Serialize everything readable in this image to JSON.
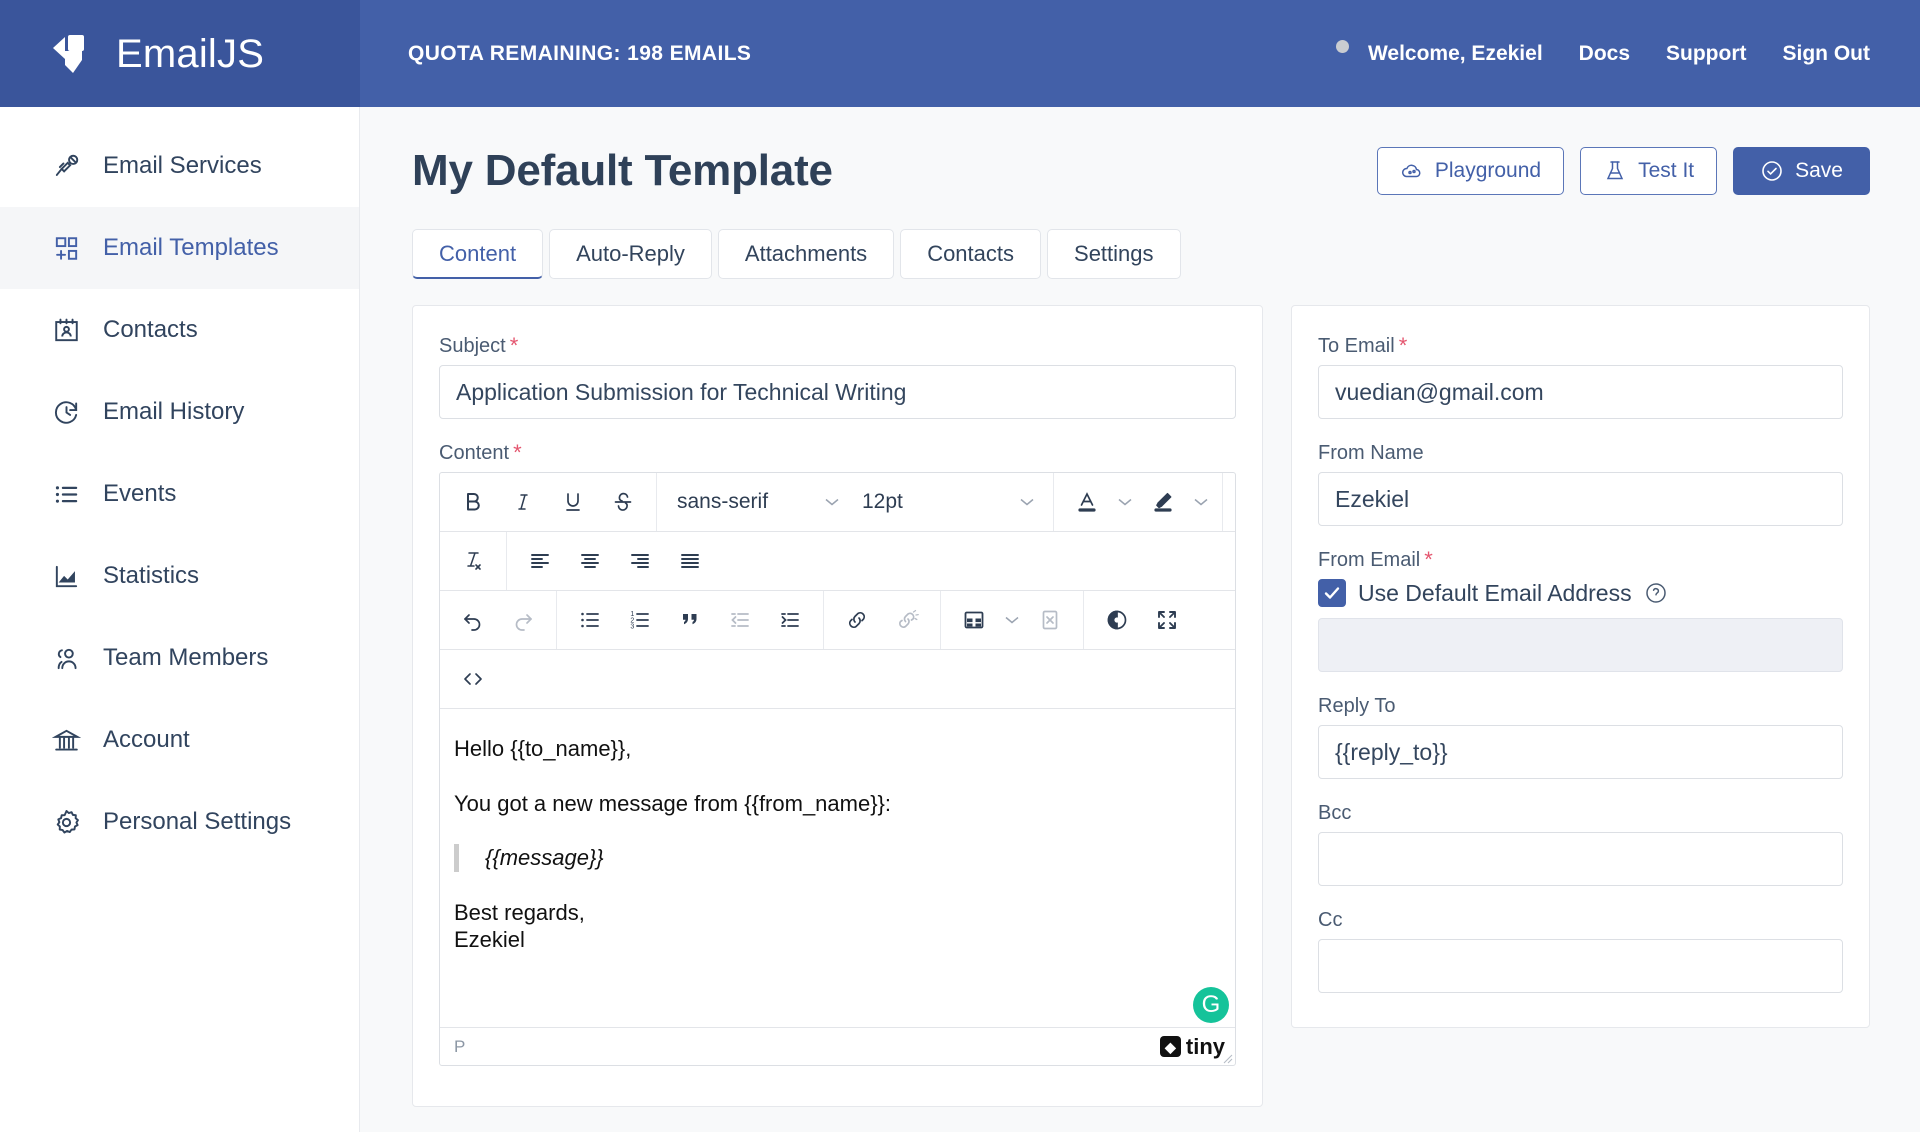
{
  "brand": {
    "name": "EmailJS",
    "logo_icon": "emailjs-logo-icon"
  },
  "header": {
    "quota": "QUOTA REMAINING: 198 EMAILS",
    "welcome": "Welcome, Ezekiel",
    "links": [
      "Docs",
      "Support",
      "Sign Out"
    ],
    "status_dot_color": "#c9ccd1",
    "bg_color": "#4360a8"
  },
  "sidebar": {
    "items": [
      {
        "label": "Email Services",
        "icon": "plug-icon",
        "active": false
      },
      {
        "label": "Email Templates",
        "icon": "template-grid-icon",
        "active": true
      },
      {
        "label": "Contacts",
        "icon": "contact-card-icon",
        "active": false
      },
      {
        "label": "Email History",
        "icon": "clock-history-icon",
        "active": false
      },
      {
        "label": "Events",
        "icon": "list-icon",
        "active": false
      },
      {
        "label": "Statistics",
        "icon": "chart-icon",
        "active": false
      },
      {
        "label": "Team Members",
        "icon": "people-icon",
        "active": false
      },
      {
        "label": "Account",
        "icon": "bank-icon",
        "active": false
      },
      {
        "label": "Personal Settings",
        "icon": "gear-icon",
        "active": false
      }
    ]
  },
  "page": {
    "title": "My Default Template",
    "actions": {
      "playground": "Playground",
      "test_it": "Test It",
      "save": "Save"
    }
  },
  "tabs": [
    {
      "label": "Content",
      "active": true
    },
    {
      "label": "Auto-Reply",
      "active": false
    },
    {
      "label": "Attachments",
      "active": false
    },
    {
      "label": "Contacts",
      "active": false
    },
    {
      "label": "Settings",
      "active": false
    }
  ],
  "content": {
    "subject": {
      "label": "Subject",
      "required": true,
      "value": "Application Submission for Technical Writing"
    },
    "content_label": {
      "label": "Content",
      "required": true
    },
    "editor": {
      "toolbar": {
        "font_family": "sans-serif",
        "font_size": "12pt"
      },
      "body": {
        "line1": "Hello {{to_name}},",
        "line2": "You got a new message from {{from_name}}:",
        "quote": "{{message}}",
        "signoff_1": "Best regards,",
        "signoff_2": "Ezekiel"
      },
      "statusbar": {
        "path": "P",
        "brand": "tiny"
      }
    }
  },
  "settings": {
    "to_email": {
      "label": "To Email",
      "required": true,
      "value": "vuedian@gmail.com"
    },
    "from_name": {
      "label": "From Name",
      "required": false,
      "value": "Ezekiel"
    },
    "from_email": {
      "label": "From Email",
      "required": true,
      "value": ""
    },
    "use_default": {
      "label": "Use Default Email Address",
      "checked": true
    },
    "reply_to": {
      "label": "Reply To",
      "required": false,
      "value": "{{reply_to}}"
    },
    "bcc": {
      "label": "Bcc",
      "required": false,
      "value": ""
    },
    "cc": {
      "label": "Cc",
      "required": false,
      "value": ""
    }
  }
}
